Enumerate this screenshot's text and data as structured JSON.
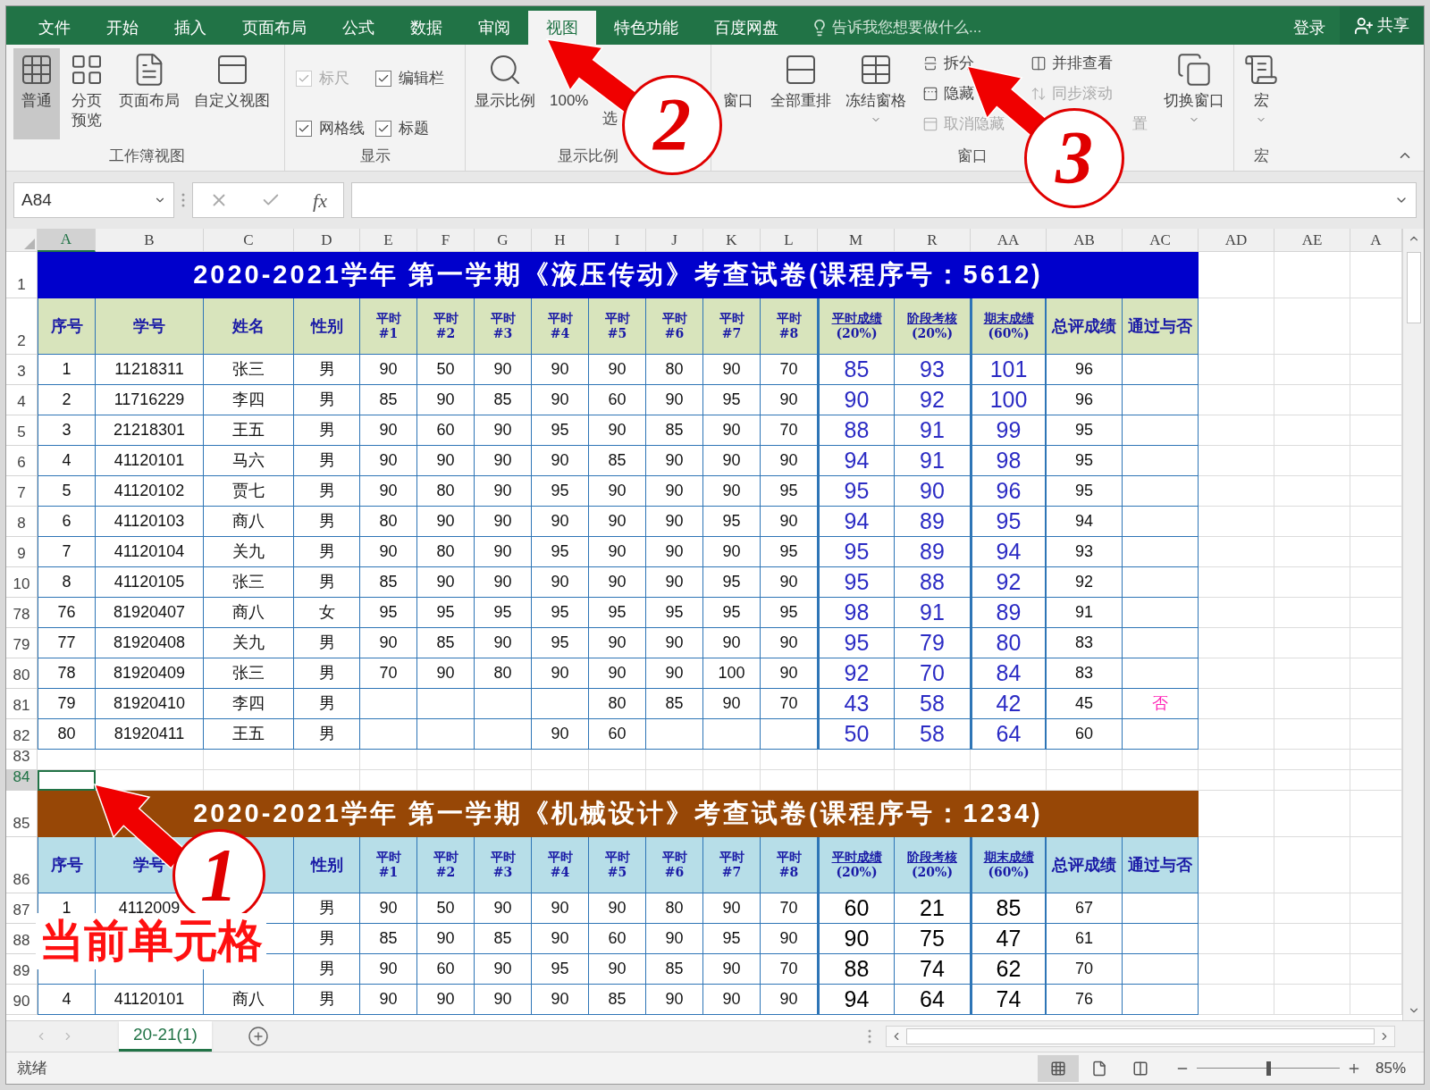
{
  "menu_tabs": [
    {
      "label": "文件",
      "selected": false
    },
    {
      "label": "开始",
      "selected": false
    },
    {
      "label": "插入",
      "selected": false
    },
    {
      "label": "页面布局",
      "selected": false
    },
    {
      "label": "公式",
      "selected": false
    },
    {
      "label": "数据",
      "selected": false
    },
    {
      "label": "审阅",
      "selected": false
    },
    {
      "label": "视图",
      "selected": true
    },
    {
      "label": "特色功能",
      "selected": false
    },
    {
      "label": "百度网盘",
      "selected": false
    }
  ],
  "tell_me": {
    "placeholder": "告诉我您想要做什么..."
  },
  "sign_in": "登录",
  "share": "共享",
  "ribbon": {
    "groups": [
      {
        "label": "工作簿视图",
        "items": [
          {
            "kind": "large",
            "label": "普通",
            "selected": true,
            "dropdown": false
          },
          {
            "kind": "large",
            "label": "分页预览",
            "selected": false,
            "dropdown": false
          },
          {
            "kind": "large",
            "label": "页面布局",
            "selected": false,
            "dropdown": false
          },
          {
            "kind": "large",
            "label": "自定义视图",
            "selected": false,
            "dropdown": false
          }
        ]
      },
      {
        "label": "显示",
        "items": [
          {
            "kind": "check",
            "label": "标尺",
            "checked": true,
            "disabled": true
          },
          {
            "kind": "check",
            "label": "编辑栏",
            "checked": true,
            "disabled": false
          },
          {
            "kind": "check",
            "label": "网格线",
            "checked": true,
            "disabled": false
          },
          {
            "kind": "check",
            "label": "标题",
            "checked": true,
            "disabled": false
          }
        ]
      },
      {
        "label": "显示比例",
        "items": [
          {
            "kind": "large",
            "label": "显示比例",
            "selected": false,
            "dropdown": false
          },
          {
            "kind": "large",
            "label": "100%",
            "selected": false,
            "dropdown": false
          },
          {
            "kind": "large2",
            "label": "选",
            "selected": false,
            "dropdown": false
          }
        ]
      },
      {
        "label": "窗口",
        "items": [
          {
            "kind": "large",
            "label": "窗口",
            "selected": false,
            "dropdown": false
          },
          {
            "kind": "large",
            "label": "全部重排",
            "selected": false,
            "dropdown": false
          },
          {
            "kind": "large",
            "label": "冻结窗格",
            "selected": false,
            "dropdown": true
          },
          {
            "kind": "small",
            "label": "拆分",
            "disabled": false
          },
          {
            "kind": "small",
            "label": "隐藏",
            "disabled": false
          },
          {
            "kind": "small",
            "label": "取消隐藏",
            "disabled": true
          },
          {
            "kind": "small",
            "label": "并排查看",
            "disabled": false
          },
          {
            "kind": "small",
            "label": "同步滚动",
            "disabled": true
          },
          {
            "kind": "fragment",
            "label": "置",
            "disabled": true
          },
          {
            "kind": "large",
            "label": "切换窗口",
            "selected": false,
            "dropdown": true
          }
        ]
      },
      {
        "label": "宏",
        "items": [
          {
            "kind": "large",
            "label": "宏",
            "selected": false,
            "dropdown": true
          }
        ]
      }
    ]
  },
  "formula_bar": {
    "name_box": "A84",
    "function_label": "fx"
  },
  "sheet": {
    "columns": [
      {
        "label": "A",
        "selected": true
      },
      {
        "label": "B",
        "selected": false
      },
      {
        "label": "C",
        "selected": false
      },
      {
        "label": "D",
        "selected": false
      },
      {
        "label": "E",
        "selected": false
      },
      {
        "label": "F",
        "selected": false
      },
      {
        "label": "G",
        "selected": false
      },
      {
        "label": "H",
        "selected": false
      },
      {
        "label": "I",
        "selected": false
      },
      {
        "label": "J",
        "selected": false
      },
      {
        "label": "K",
        "selected": false
      },
      {
        "label": "L",
        "selected": false
      },
      {
        "label": "M",
        "selected": false
      },
      {
        "label": "R",
        "selected": false
      },
      {
        "label": "AA",
        "selected": false
      },
      {
        "label": "AB",
        "selected": false
      },
      {
        "label": "AC",
        "selected": false
      },
      {
        "label": "AD",
        "selected": false
      },
      {
        "label": "AE",
        "selected": false
      },
      {
        "label": "A",
        "selected": false
      }
    ],
    "rows": [
      {
        "number": "1",
        "kind": "title",
        "color": "#0000cc",
        "selected": false,
        "text": "2020-2021学年 第一学期《液压传动》考查试卷(课程序号：5612)"
      },
      {
        "number": "2",
        "kind": "head",
        "color": "#d8e4bc",
        "selected": false,
        "cells": [
          {
            "lines": [
              "序号"
            ]
          },
          {
            "lines": [
              "学号"
            ]
          },
          {
            "lines": [
              "姓名"
            ]
          },
          {
            "lines": [
              "性别"
            ]
          },
          {
            "lines": [
              "平时",
              "#1"
            ]
          },
          {
            "lines": [
              "平时",
              "#2"
            ]
          },
          {
            "lines": [
              "平时",
              "#3"
            ]
          },
          {
            "lines": [
              "平时",
              "#4"
            ]
          },
          {
            "lines": [
              "平时",
              "#5"
            ]
          },
          {
            "lines": [
              "平时",
              "#6"
            ]
          },
          {
            "lines": [
              "平时",
              "#7"
            ]
          },
          {
            "lines": [
              "平时",
              "#8"
            ]
          },
          {
            "lines": [
              "平时成绩",
              "(20%)"
            ],
            "underline": true
          },
          {
            "lines": [
              "阶段考核",
              "(20%)"
            ],
            "underline": true
          },
          {
            "lines": [
              "期末成绩",
              "(60%)"
            ],
            "underline": true
          },
          {
            "lines": [
              "总评成绩"
            ]
          },
          {
            "lines": [
              "通过与否"
            ]
          }
        ]
      },
      {
        "number": "3",
        "kind": "data",
        "color": "#2b2bc4",
        "selected": false,
        "cells": [
          "1",
          "11218311",
          "张三",
          "男",
          "90",
          "50",
          "90",
          "90",
          "90",
          "80",
          "90",
          "70",
          "85",
          "93",
          "101",
          "96",
          null
        ]
      },
      {
        "number": "4",
        "kind": "data",
        "color": "#2b2bc4",
        "selected": false,
        "cells": [
          "2",
          "11716229",
          "李四",
          "男",
          "85",
          "90",
          "85",
          "90",
          "60",
          "90",
          "95",
          "90",
          "90",
          "92",
          "100",
          "96",
          null
        ]
      },
      {
        "number": "5",
        "kind": "data",
        "color": "#2b2bc4",
        "selected": false,
        "cells": [
          "3",
          "21218301",
          "王五",
          "男",
          "90",
          "60",
          "90",
          "95",
          "90",
          "85",
          "90",
          "70",
          "88",
          "91",
          "99",
          "95",
          null
        ]
      },
      {
        "number": "6",
        "kind": "data",
        "color": "#2b2bc4",
        "selected": false,
        "cells": [
          "4",
          "41120101",
          "马六",
          "男",
          "90",
          "90",
          "90",
          "90",
          "85",
          "90",
          "90",
          "90",
          "94",
          "91",
          "98",
          "95",
          null
        ]
      },
      {
        "number": "7",
        "kind": "data",
        "color": "#2b2bc4",
        "selected": false,
        "cells": [
          "5",
          "41120102",
          "贾七",
          "男",
          "90",
          "80",
          "90",
          "95",
          "90",
          "90",
          "90",
          "95",
          "95",
          "90",
          "96",
          "95",
          null
        ]
      },
      {
        "number": "8",
        "kind": "data",
        "color": "#2b2bc4",
        "selected": false,
        "cells": [
          "6",
          "41120103",
          "商八",
          "男",
          "80",
          "90",
          "90",
          "90",
          "90",
          "90",
          "95",
          "90",
          "94",
          "89",
          "95",
          "94",
          null
        ]
      },
      {
        "number": "9",
        "kind": "data",
        "color": "#2b2bc4",
        "selected": false,
        "cells": [
          "7",
          "41120104",
          "关九",
          "男",
          "90",
          "80",
          "90",
          "95",
          "90",
          "90",
          "90",
          "95",
          "95",
          "89",
          "94",
          "93",
          null
        ]
      },
      {
        "number": "10",
        "kind": "data",
        "color": "#2b2bc4",
        "selected": false,
        "cells": [
          "8",
          "41120105",
          "张三",
          "男",
          "85",
          "90",
          "90",
          "90",
          "90",
          "90",
          "95",
          "90",
          "95",
          "88",
          "92",
          "92",
          null
        ]
      },
      {
        "number": "78",
        "kind": "data",
        "color": "#2b2bc4",
        "selected": false,
        "cells": [
          "76",
          "81920407",
          "商八",
          "女",
          "95",
          "95",
          "95",
          "95",
          "95",
          "95",
          "95",
          "95",
          "98",
          "91",
          "89",
          "91",
          null
        ]
      },
      {
        "number": "79",
        "kind": "data",
        "color": "#2b2bc4",
        "selected": false,
        "cells": [
          "77",
          "81920408",
          "关九",
          "男",
          "90",
          "85",
          "90",
          "95",
          "90",
          "90",
          "90",
          "90",
          "95",
          "79",
          "80",
          "83",
          null
        ]
      },
      {
        "number": "80",
        "kind": "data",
        "color": "#2b2bc4",
        "selected": false,
        "cells": [
          "78",
          "81920409",
          "张三",
          "男",
          "70",
          "90",
          "80",
          "90",
          "90",
          "90",
          "100",
          "90",
          "92",
          "70",
          "84",
          "83",
          null
        ]
      },
      {
        "number": "81",
        "kind": "data",
        "color": "#2b2bc4",
        "selected": false,
        "cells": [
          "79",
          "81920410",
          "李四",
          "男",
          null,
          null,
          null,
          null,
          "80",
          "85",
          "90",
          "70",
          "43",
          "58",
          "42",
          "45",
          "否"
        ]
      },
      {
        "number": "82",
        "kind": "data",
        "color": "#2b2bc4",
        "selected": false,
        "cells": [
          "80",
          "81920411",
          "王五",
          "男",
          null,
          null,
          null,
          "90",
          "60",
          null,
          null,
          null,
          "50",
          "58",
          "64",
          "60",
          null
        ]
      },
      {
        "number": "83",
        "kind": "blank",
        "selected": false
      },
      {
        "number": "84",
        "kind": "blank",
        "selected": true
      },
      {
        "number": "85",
        "kind": "title",
        "color": "#974706",
        "selected": false,
        "text": "2020-2021学年 第一学期《机械设计》考查试卷(课程序号：1234)"
      },
      {
        "number": "86",
        "kind": "head",
        "color": "#b7dee8",
        "selected": false,
        "cells": [
          {
            "lines": [
              "序号"
            ]
          },
          {
            "lines": [
              "学号"
            ]
          },
          null,
          {
            "lines": [
              "性别"
            ]
          },
          {
            "lines": [
              "平时",
              "#1"
            ]
          },
          {
            "lines": [
              "平时",
              "#2"
            ]
          },
          {
            "lines": [
              "平时",
              "#3"
            ]
          },
          {
            "lines": [
              "平时",
              "#4"
            ]
          },
          {
            "lines": [
              "平时",
              "#5"
            ]
          },
          {
            "lines": [
              "平时",
              "#6"
            ]
          },
          {
            "lines": [
              "平时",
              "#7"
            ]
          },
          {
            "lines": [
              "平时",
              "#8"
            ]
          },
          {
            "lines": [
              "平时成绩",
              "(20%)"
            ],
            "underline": true
          },
          {
            "lines": [
              "阶段考核",
              "(20%)"
            ],
            "underline": true
          },
          {
            "lines": [
              "期末成绩",
              "(60%)"
            ],
            "underline": true
          },
          {
            "lines": [
              "总评成绩"
            ]
          },
          {
            "lines": [
              "通过与否"
            ]
          }
        ]
      },
      {
        "number": "87",
        "kind": "data",
        "color": "#000000",
        "selected": false,
        "cells": [
          "1",
          "4112009",
          null,
          "男",
          "90",
          "50",
          "90",
          "90",
          "90",
          "80",
          "90",
          "70",
          "60",
          "21",
          "85",
          "67",
          null
        ]
      },
      {
        "number": "88",
        "kind": "data",
        "color": "#000000",
        "selected": false,
        "cells": [
          null,
          null,
          null,
          "男",
          "85",
          "90",
          "85",
          "90",
          "60",
          "90",
          "95",
          "90",
          "90",
          "75",
          "47",
          "61",
          null
        ]
      },
      {
        "number": "89",
        "kind": "data",
        "color": "#000000",
        "selected": false,
        "cells": [
          null,
          null,
          null,
          "男",
          "90",
          "60",
          "90",
          "95",
          "90",
          "85",
          "90",
          "70",
          "88",
          "74",
          "62",
          "70",
          null
        ]
      },
      {
        "number": "90",
        "kind": "data",
        "color": "#000000",
        "selected": false,
        "cells": [
          "4",
          "41120101",
          "商八",
          "男",
          "90",
          "90",
          "90",
          "90",
          "85",
          "90",
          "90",
          "90",
          "94",
          "64",
          "74",
          "76",
          null
        ]
      }
    ]
  },
  "sheet_tabs": [
    {
      "label": "20-21(1)",
      "selected": true
    }
  ],
  "status_bar": {
    "text": "就绪",
    "view_buttons": [
      {
        "selected": true
      },
      {
        "selected": false
      },
      {
        "selected": false
      }
    ],
    "zoom": {
      "level": 0.5,
      "reading": "85%"
    }
  },
  "annotations": [
    {
      "number": "1"
    },
    {
      "number": "2"
    },
    {
      "number": "3"
    }
  ],
  "callout": "当前单元格"
}
